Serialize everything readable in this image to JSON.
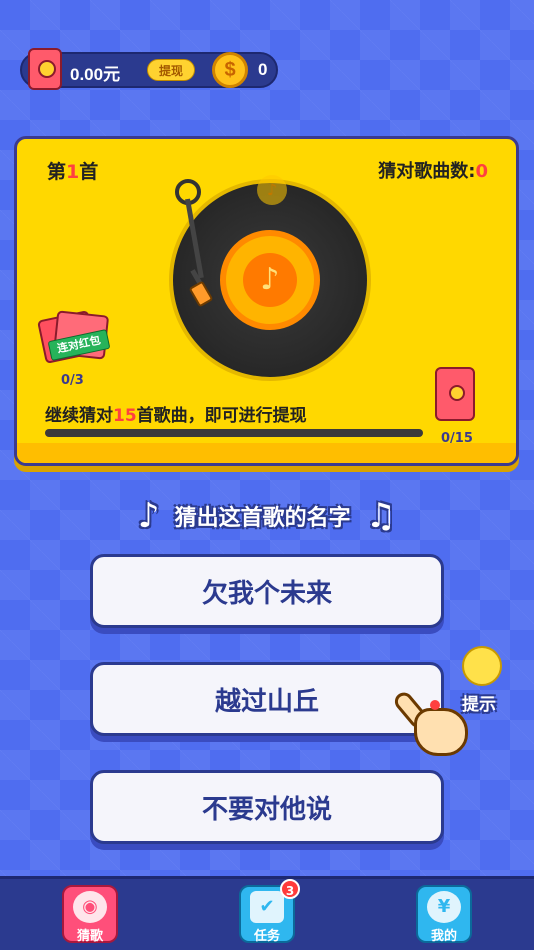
{
  "topbar": {
    "balance": "0.00元",
    "withdraw_label": "提现",
    "coin_symbol": "$",
    "coin_count": "0"
  },
  "card": {
    "song_no_prefix": "第",
    "song_no_num": "1",
    "song_no_suffix": "首",
    "guess_count_label": "猜对歌曲数:",
    "guess_count_value": "0",
    "record_note": "♪",
    "streak_tag": "连对红包",
    "streak_progress": "0/3",
    "withdraw_hint_prefix": "继续猜对",
    "withdraw_hint_num": "15",
    "withdraw_hint_suffix": "首歌曲，即可进行提现",
    "packet_progress": "0/15"
  },
  "question": {
    "text": "猜出这首歌的名字",
    "note_left": "♪",
    "note_right": "♫"
  },
  "options": [
    {
      "label": "欠我个未来"
    },
    {
      "label": "越过山丘"
    },
    {
      "label": "不要对他说"
    }
  ],
  "hint": {
    "label": "提示"
  },
  "bottom_nav": {
    "items": [
      {
        "label": "猜歌",
        "icon": "record-icon",
        "glyph": "◉"
      },
      {
        "label": "任务",
        "icon": "task-icon",
        "glyph": "✔"
      },
      {
        "label": "我的",
        "icon": "money-bag-icon",
        "glyph": "¥"
      }
    ],
    "task_badge": "3"
  },
  "colors": {
    "background": "#4f6df0",
    "card": "#ffd800",
    "accent_red": "#ff4040",
    "navy": "#2b3a8f"
  }
}
